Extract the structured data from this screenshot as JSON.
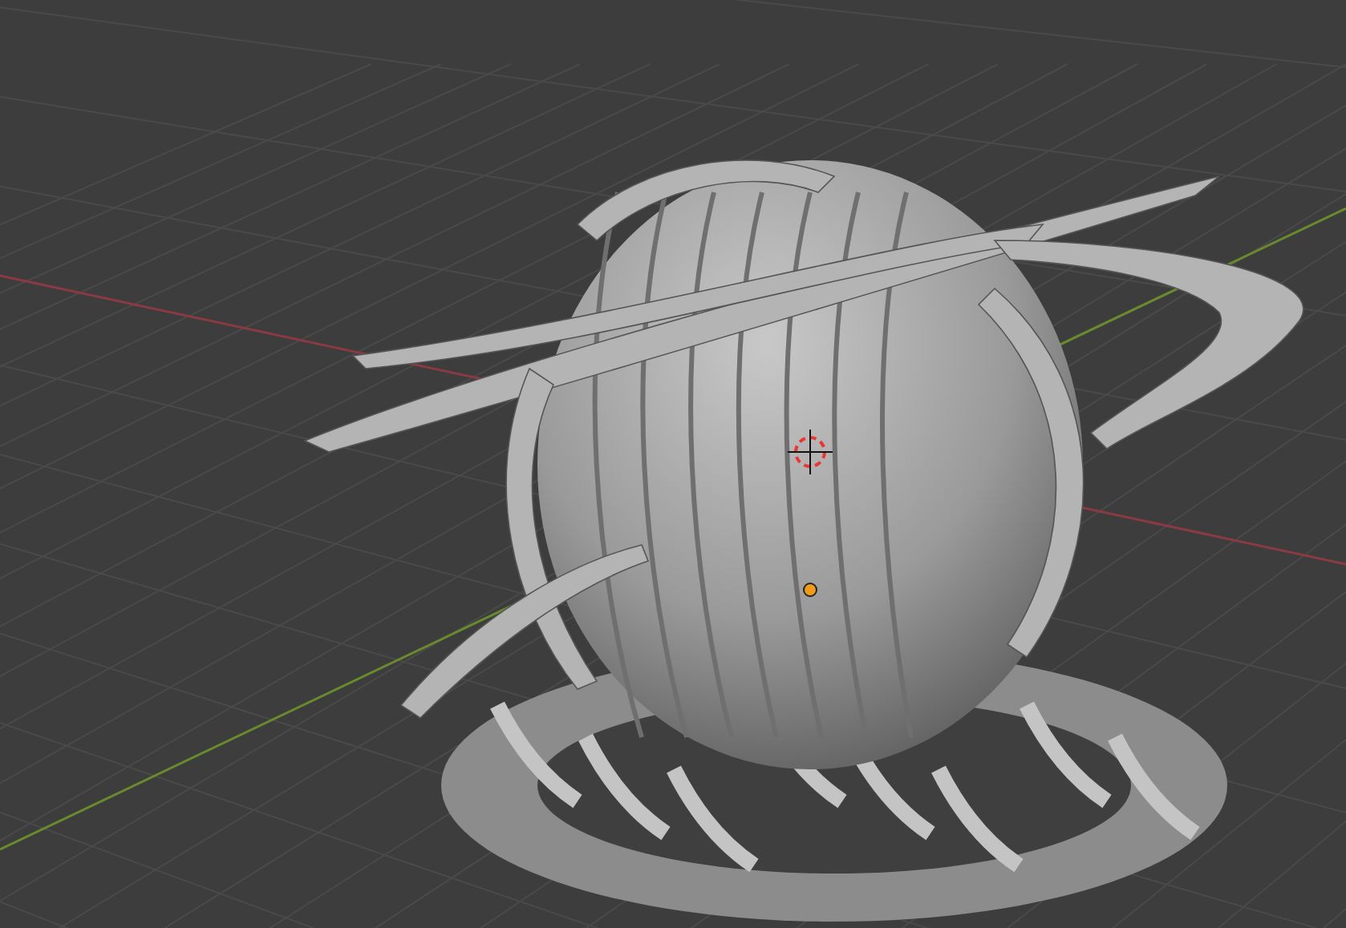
{
  "viewport": {
    "object_selected": true,
    "cursor_3d": true
  }
}
